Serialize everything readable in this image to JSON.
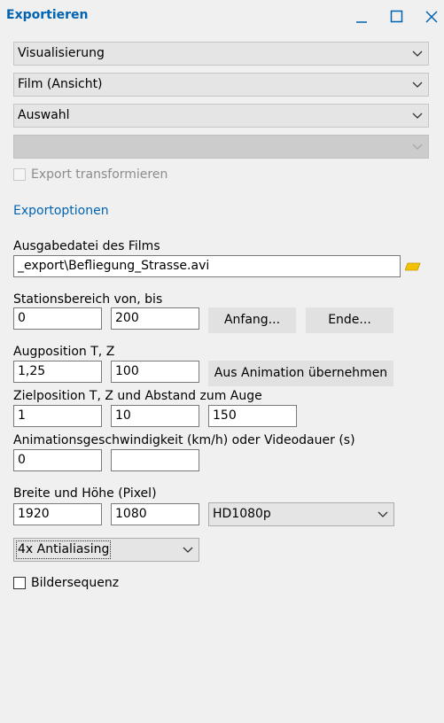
{
  "window": {
    "title": "Exportieren"
  },
  "dropdowns": {
    "type": "Visualisierung",
    "mode": "Film (Ansicht)",
    "selection": "Auswahl",
    "extra": ""
  },
  "export_transform": {
    "label": "Export transformieren",
    "checked": false
  },
  "section_title": "Exportoptionen",
  "output_file": {
    "label": "Ausgabedatei des Films",
    "value": "_export\\Befliegung_Strasse.avi"
  },
  "station_range": {
    "label": "Stationsbereich von, bis",
    "from": "0",
    "to": "200",
    "start_button": "Anfang...",
    "end_button": "Ende..."
  },
  "eye_position": {
    "label": "Augposition T, Z",
    "t": "1,25",
    "z": "100",
    "from_animation_button": "Aus Animation übernehmen"
  },
  "target_position": {
    "label": "Zielposition T, Z und Abstand zum Auge",
    "t": "1",
    "z": "10",
    "distance": "150"
  },
  "animation_speed": {
    "label": "Animationsgeschwindigkeit (km/h) oder Videodauer (s)",
    "speed": "0",
    "duration": ""
  },
  "size": {
    "label": "Breite und Höhe (Pixel)",
    "width": "1920",
    "height": "1080",
    "preset": "HD1080p"
  },
  "antialiasing": "4x Antialiasing",
  "image_sequence": {
    "label": "Bildersequenz",
    "checked": false
  },
  "colors": {
    "accent": "#0063b1",
    "folder": "#f2c200"
  }
}
